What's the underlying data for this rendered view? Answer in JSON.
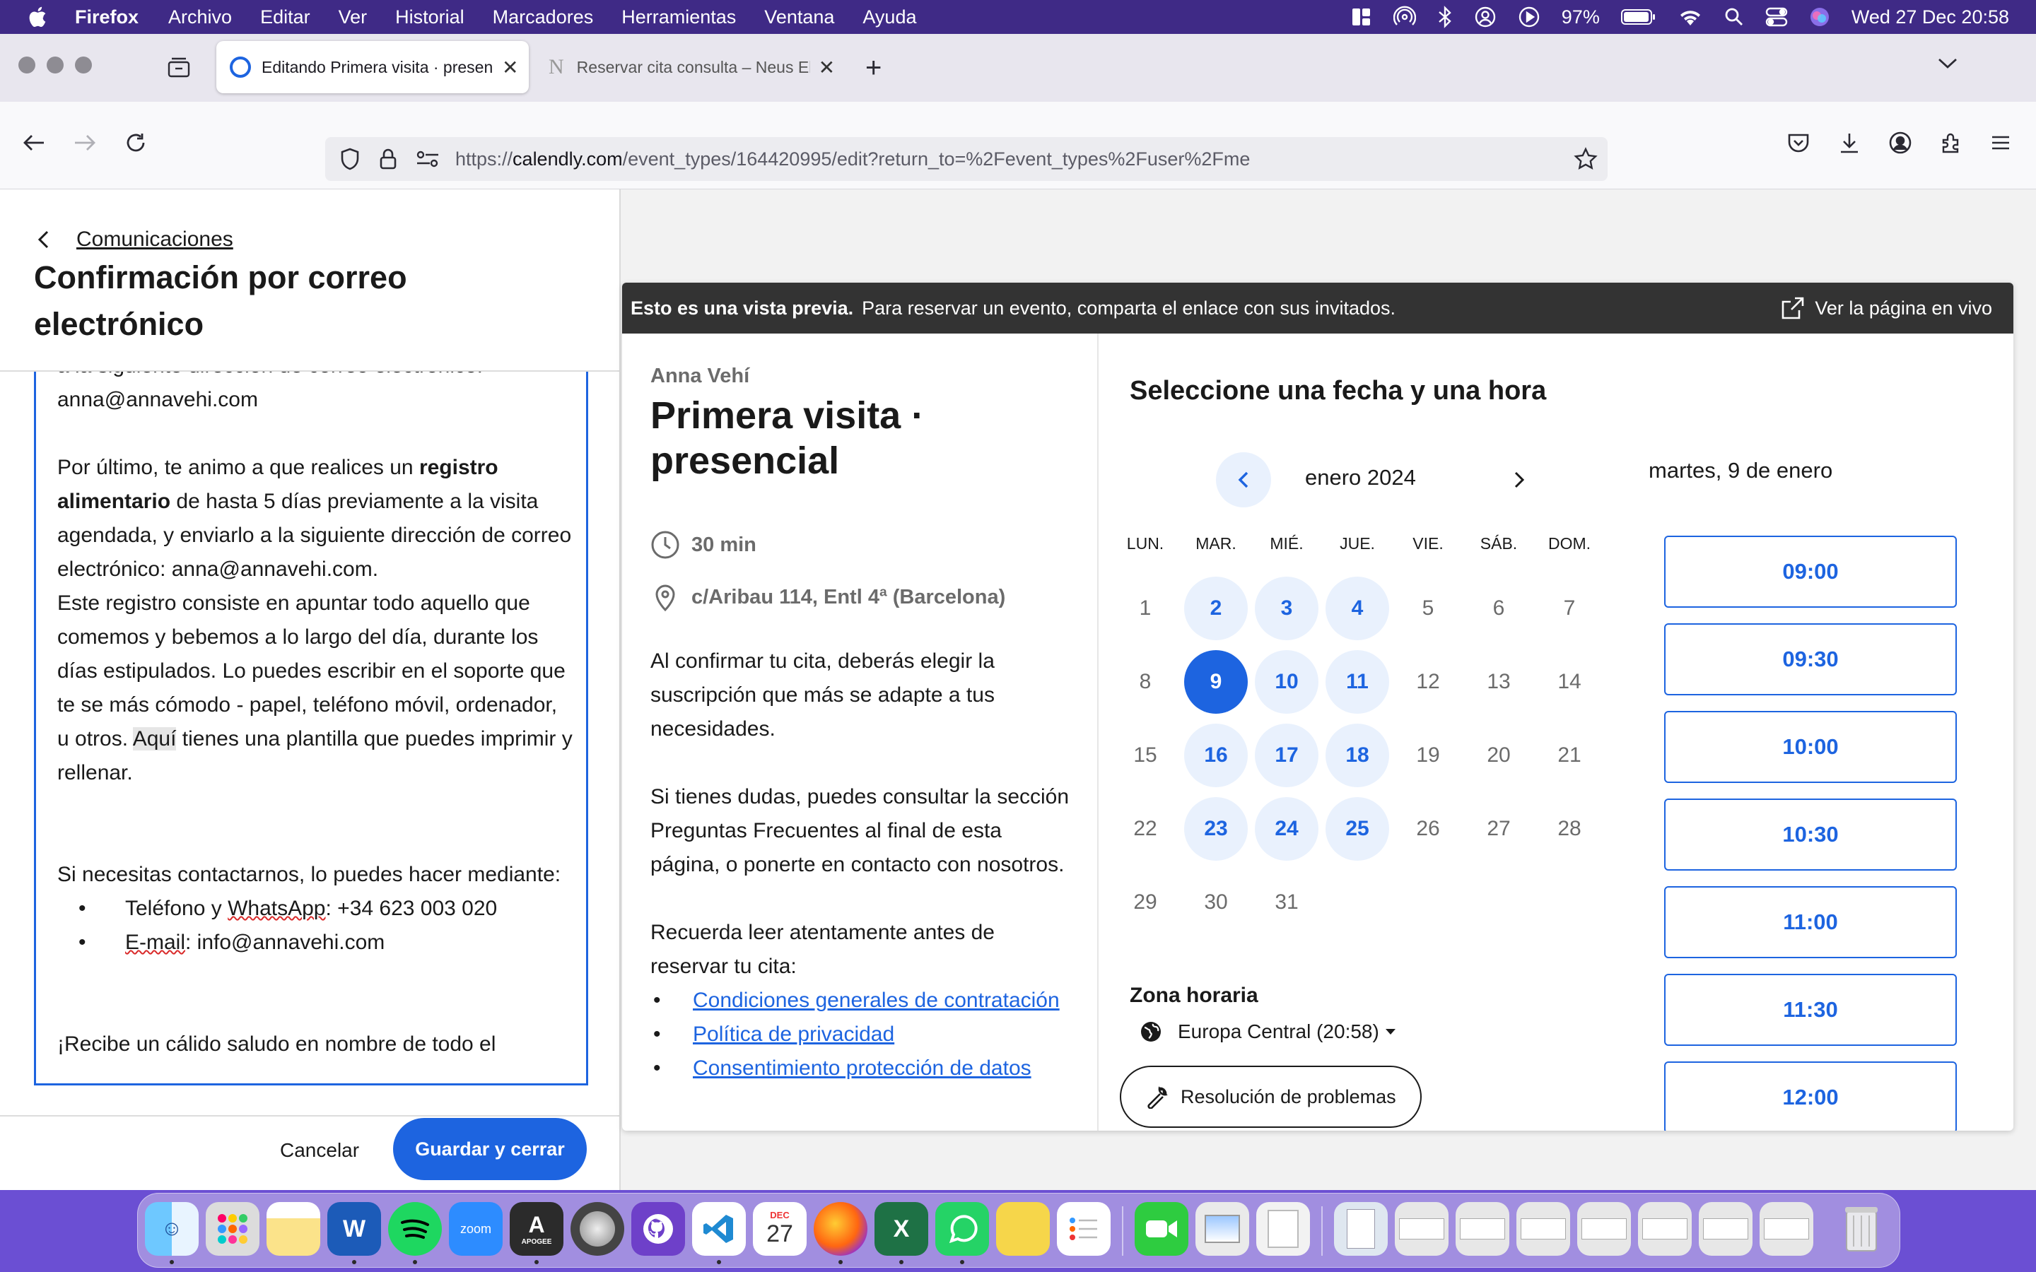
{
  "menubar": {
    "app": "Firefox",
    "items": [
      "Archivo",
      "Editar",
      "Ver",
      "Historial",
      "Marcadores",
      "Herramientas",
      "Ventana",
      "Ayuda"
    ],
    "battery": "97%",
    "datetime": "Wed 27 Dec  20:58"
  },
  "browser": {
    "tabs": [
      {
        "label": "Editando Primera visita · presencial",
        "active": true
      },
      {
        "label": "Reservar cita consulta – Neus El",
        "active": false
      }
    ],
    "url_prefix": "https://",
    "url_domain": "calendly.com",
    "url_path": "/event_types/164420995/edit?return_to=%2Fevent_types%2Fuser%2Fme"
  },
  "editor_panel": {
    "back_label": "Comunicaciones",
    "title": "Confirmación por correo electrónico",
    "body": {
      "line0": "a la siguiente dirección de correo electrónico:",
      "line1": "anna@annavehi.com",
      "p2_a": "Por último, te animo a que realices un ",
      "p2_b": "registro alimentario",
      "p2_c": " de hasta 5 días previamente a la visita agendada, y enviarlo a la siguiente dirección de correo electrónico: anna@annavehi.com.",
      "p3_a": "Este registro consiste en apuntar todo aquello que comemos y bebemos a lo largo del día, durante los días estipulados. Lo puedes escribir en el soporte que te se más cómodo - papel, teléfono móvil, ordenador, u otros. ",
      "p3_b": "Aquí",
      "p3_c": " tienes una plantilla que puedes imprimir y rellenar.",
      "p4": "Si necesitas contactarnos, lo puedes hacer mediante:",
      "li1_a": "Teléfono y ",
      "li1_b": "WhatsApp",
      "li1_c": ": +34 623 003 020",
      "li2_a": "E-mail",
      "li2_b": ": info@annavehi.com",
      "cut": "¡Recibe un cálido saludo en nombre de todo el"
    },
    "cancel_label": "Cancelar",
    "save_label": "Guardar y cerrar"
  },
  "preview": {
    "banner_bold": "Esto es una vista previa.",
    "banner_text": "Para reservar un evento, comparta el enlace con sus invitados.",
    "live_link": "Ver la página en vivo",
    "host": "Anna Vehí",
    "event_title": "Primera visita · presencial",
    "duration": "30 min",
    "location": "c/Aribau 114, Entl 4ª (Barcelona)",
    "desc_p1": "Al confirmar tu cita, deberás elegir la suscripción que más se adapte a tus necesidades.",
    "desc_p2": "Si tienes dudas, puedes consultar la sección Preguntas Frecuentes al final de esta página, o ponerte en contacto con nosotros.",
    "desc_p3": "Recuerda leer atentamente antes de reservar tu cita:",
    "links": [
      "Condiciones generales de contratación",
      "Política de privacidad",
      "Consentimiento protección de datos"
    ],
    "calendar": {
      "title": "Seleccione una fecha y una hora",
      "month": "enero 2024",
      "weekdays": [
        "LUN.",
        "MAR.",
        "MIÉ.",
        "JUE.",
        "VIE.",
        "SÁB.",
        "DOM."
      ],
      "days": [
        1,
        2,
        3,
        4,
        5,
        6,
        7,
        8,
        9,
        10,
        11,
        12,
        13,
        14,
        15,
        16,
        17,
        18,
        19,
        20,
        21,
        22,
        23,
        24,
        25,
        26,
        27,
        28,
        29,
        30,
        31
      ],
      "available": [
        2,
        3,
        4,
        9,
        10,
        11,
        16,
        17,
        18,
        23,
        24,
        25
      ],
      "selected": 9,
      "first_weekday_offset": 0
    },
    "selected_date": "martes, 9 de enero",
    "times": [
      "09:00",
      "09:30",
      "10:00",
      "10:30",
      "11:00",
      "11:30",
      "12:00"
    ],
    "timezone_label": "Zona horaria",
    "timezone": "Europa Central (20:58)",
    "troubleshoot": "Resolución de problemas"
  },
  "dock": {
    "zoom_label": "zoom",
    "apogee_label": "APOGEE",
    "calendar_month": "DEC",
    "calendar_day": "27"
  },
  "colors": {
    "accent": "#1d64e0",
    "available_bg": "#e9f1fd",
    "menubar": "#3f2a86",
    "banner": "#333333"
  }
}
